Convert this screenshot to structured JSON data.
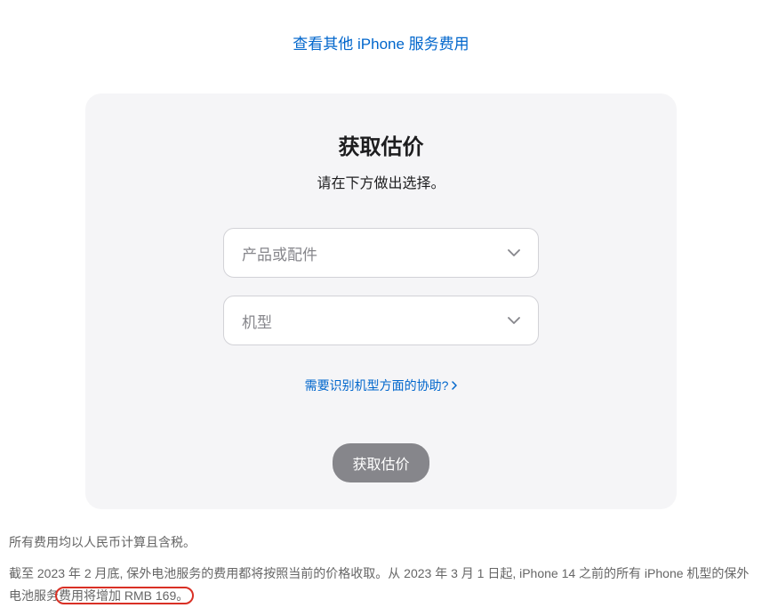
{
  "topLink": {
    "label": "查看其他 iPhone 服务费用"
  },
  "card": {
    "title": "获取估价",
    "subtitle": "请在下方做出选择。",
    "selectProduct": {
      "placeholder": "产品或配件"
    },
    "selectModel": {
      "placeholder": "机型"
    },
    "helpLink": {
      "label": "需要识别机型方面的协助?"
    },
    "button": {
      "label": "获取估价"
    }
  },
  "footer": {
    "line1": "所有费用均以人民币计算且含税。",
    "line2_part1": "截至 2023 年 2 月底, 保外电池服务的费用都将按照当前的价格收取。从 2023 年 3 月 1 日起, iPhone 14 之前的所有 iPhone 机型的保外电池服务",
    "line2_highlight": "费用将增加 RMB 169。"
  }
}
